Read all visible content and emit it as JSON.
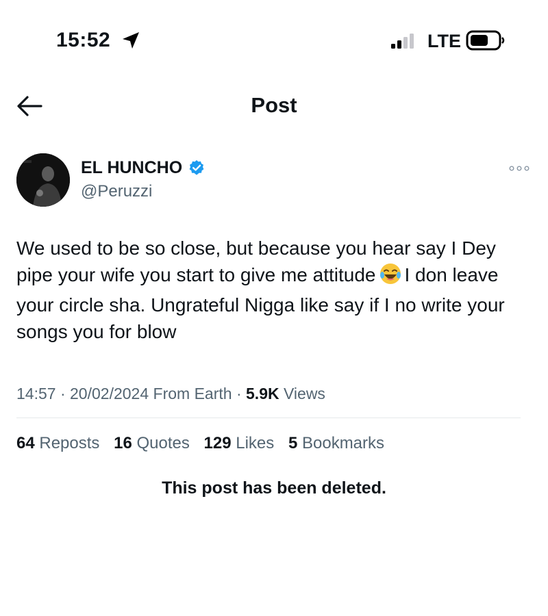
{
  "status_bar": {
    "time": "15:52",
    "network": "LTE",
    "icons": [
      "location-arrow-icon",
      "signal-icon",
      "battery-icon"
    ]
  },
  "nav": {
    "title": "Post",
    "back_icon": "arrow-left-icon"
  },
  "post": {
    "author": {
      "name": "EL HUNCHO",
      "handle": "@Peruzzi",
      "verified": true
    },
    "text_parts": [
      "We used to be so close, but because you hear say I Dey pipe your wife you start to give me attitude",
      "I don leave your circle sha. Ungrateful Nigga like say if I no write your songs you for blow"
    ],
    "emoji": "face-with-tears-of-joy-icon",
    "meta": {
      "time": "14:57",
      "date": "20/02/2024",
      "source": "From Earth",
      "views_count": "5.9K",
      "views_label": "Views"
    },
    "stats": [
      {
        "count": "64",
        "label": "Reposts"
      },
      {
        "count": "16",
        "label": "Quotes"
      },
      {
        "count": "129",
        "label": "Likes"
      },
      {
        "count": "5",
        "label": "Bookmarks"
      }
    ],
    "deleted_notice": "This post has been deleted."
  },
  "colors": {
    "text": "#0f1419",
    "muted": "#536471",
    "verified": "#1d9bf0",
    "divider": "#e6e9eb"
  }
}
